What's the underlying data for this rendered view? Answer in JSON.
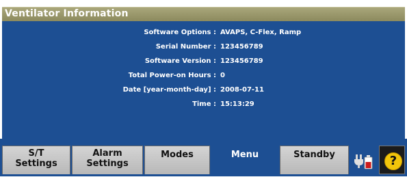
{
  "window": {
    "title": "Ventilator Information"
  },
  "info": [
    {
      "label": "Software Options :",
      "value": "AVAPS, C-Flex, Ramp"
    },
    {
      "label": "Serial Number :",
      "value": "123456789"
    },
    {
      "label": "Software Version :",
      "value": "123456789"
    },
    {
      "label": "Total Power-on Hours :",
      "value": "0"
    },
    {
      "label": "Date [year-month-day] :",
      "value": "2008-07-11"
    },
    {
      "label": "Time :",
      "value": "15:13:29"
    }
  ],
  "tabs": [
    {
      "line1": "S/T",
      "line2": "Settings",
      "active": false
    },
    {
      "line1": "Alarm",
      "line2": "Settings",
      "active": false
    },
    {
      "line1": "Modes",
      "line2": "",
      "active": false
    },
    {
      "line1": "Menu",
      "line2": "",
      "active": true
    },
    {
      "line1": "Standby",
      "line2": "",
      "active": false
    }
  ],
  "icons": {
    "status": "ac-power-battery-icon",
    "help": "question-mark-help-icon"
  },
  "help_glyph": "?",
  "colors": {
    "panel": "#1d4f93",
    "titlebar": "#9a9870",
    "tab": "#c6c6c6",
    "help": "#f2c60b"
  }
}
